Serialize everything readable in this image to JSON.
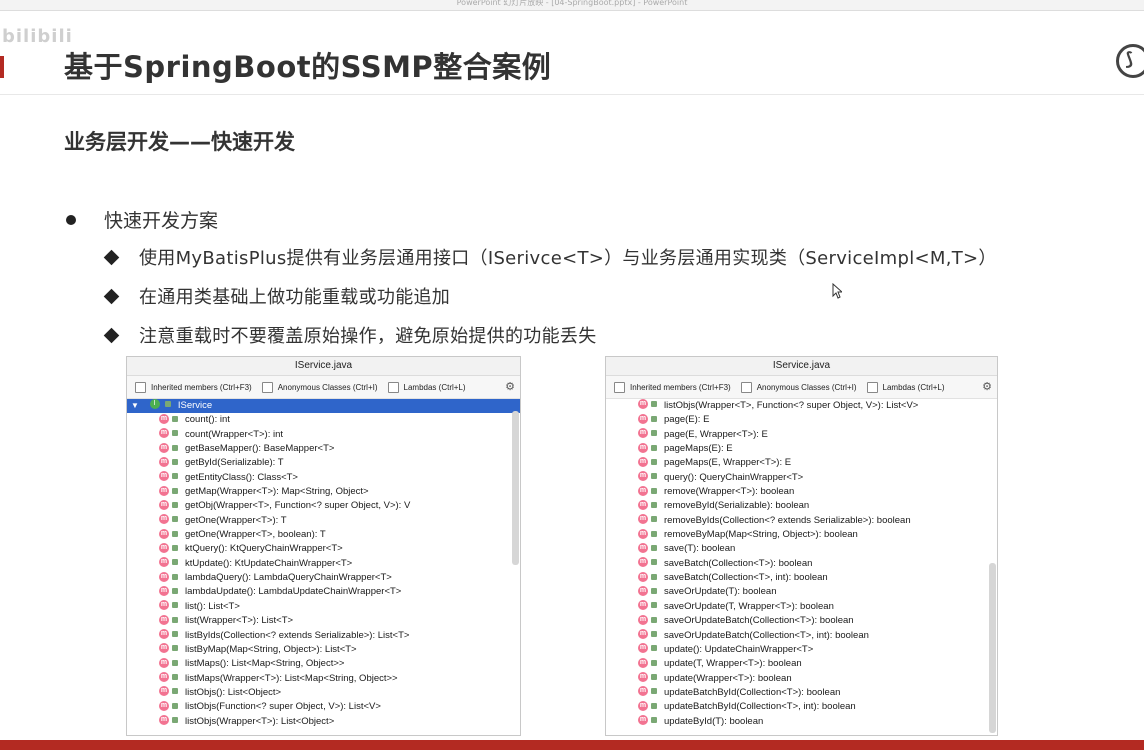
{
  "window_title": "PowerPoint 幻灯片放映 - [04-SpringBoot.pptx] - PowerPoint",
  "watermark": "bilibili",
  "title": "基于SpringBoot的SSMP整合案例",
  "subtitle": "业务层开发——快速开发",
  "bullet": "快速开发方案",
  "sub_bullets": [
    "使用MyBatisPlus提供有业务层通用接口（ISerivce<T>）与业务层通用实现类（ServiceImpl<M,T>）",
    "在通用类基础上做功能重载或功能追加",
    "注意重载时不要覆盖原始操作，避免原始提供的功能丢失"
  ],
  "panels": [
    {
      "title": "IService.java",
      "options": [
        "Inherited members (Ctrl+F3)",
        "Anonymous Classes (Ctrl+I)",
        "Lambdas (Ctrl+L)"
      ],
      "root": "IService",
      "members": [
        "count(): int",
        "count(Wrapper<T>): int",
        "getBaseMapper(): BaseMapper<T>",
        "getById(Serializable): T",
        "getEntityClass(): Class<T>",
        "getMap(Wrapper<T>): Map<String, Object>",
        "getObj(Wrapper<T>, Function<? super Object, V>): V",
        "getOne(Wrapper<T>): T",
        "getOne(Wrapper<T>, boolean): T",
        "ktQuery(): KtQueryChainWrapper<T>",
        "ktUpdate(): KtUpdateChainWrapper<T>",
        "lambdaQuery(): LambdaQueryChainWrapper<T>",
        "lambdaUpdate(): LambdaUpdateChainWrapper<T>",
        "list(): List<T>",
        "list(Wrapper<T>): List<T>",
        "listByIds(Collection<? extends Serializable>): List<T>",
        "listByMap(Map<String, Object>): List<T>",
        "listMaps(): List<Map<String, Object>>",
        "listMaps(Wrapper<T>): List<Map<String, Object>>",
        "listObjs(): List<Object>",
        "listObjs(Function<? super Object, V>): List<V>",
        "listObjs(Wrapper<T>): List<Object>"
      ]
    },
    {
      "title": "IService.java",
      "options": [
        "Inherited members (Ctrl+F3)",
        "Anonymous Classes (Ctrl+I)",
        "Lambdas (Ctrl+L)"
      ],
      "members": [
        "listObjs(Wrapper<T>, Function<? super Object, V>): List<V>",
        "page(E): E",
        "page(E, Wrapper<T>): E",
        "pageMaps(E): E",
        "pageMaps(E, Wrapper<T>): E",
        "query(): QueryChainWrapper<T>",
        "remove(Wrapper<T>): boolean",
        "removeById(Serializable): boolean",
        "removeByIds(Collection<? extends Serializable>): boolean",
        "removeByMap(Map<String, Object>): boolean",
        "save(T): boolean",
        "saveBatch(Collection<T>): boolean",
        "saveBatch(Collection<T>, int): boolean",
        "saveOrUpdate(T): boolean",
        "saveOrUpdate(T, Wrapper<T>): boolean",
        "saveOrUpdateBatch(Collection<T>): boolean",
        "saveOrUpdateBatch(Collection<T>, int): boolean",
        "update(): UpdateChainWrapper<T>",
        "update(T, Wrapper<T>): boolean",
        "update(Wrapper<T>): boolean",
        "updateBatchById(Collection<T>): boolean",
        "updateBatchById(Collection<T>, int): boolean",
        "updateById(T): boolean"
      ]
    }
  ]
}
